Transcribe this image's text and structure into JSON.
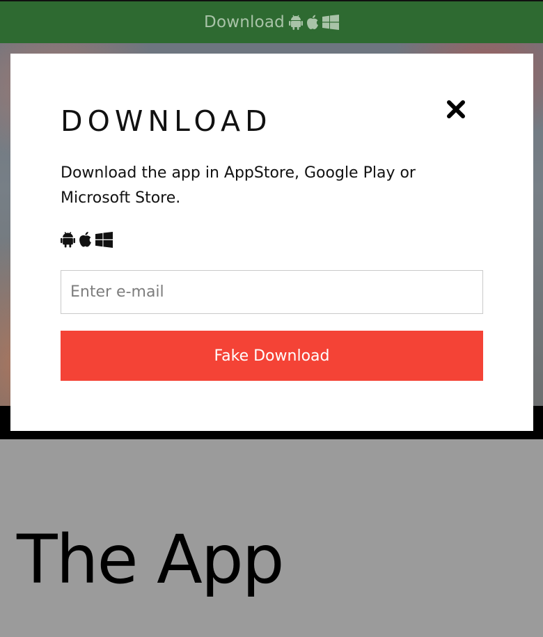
{
  "topbar": {
    "label": "Download",
    "icons": [
      "android-icon",
      "apple-icon",
      "windows-icon"
    ],
    "bg_color": "#2e6a31"
  },
  "modal": {
    "title": "DOWNLOAD",
    "description": "Download the app in AppStore, Google Play or Microsoft Store.",
    "icons": [
      "android-icon",
      "apple-icon",
      "windows-icon"
    ],
    "email_placeholder": "Enter e-mail",
    "email_value": "",
    "button_label": "Fake Download",
    "button_color": "#f44336",
    "close_icon": "close-icon"
  },
  "page": {
    "heading": "The App"
  }
}
